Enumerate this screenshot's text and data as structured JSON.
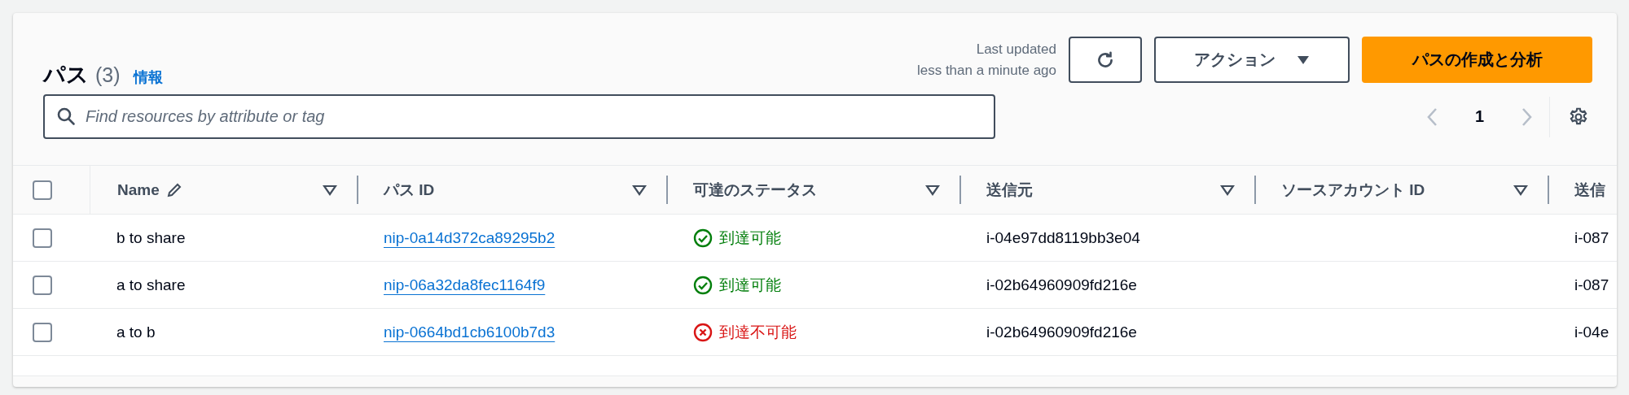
{
  "header": {
    "title": "パス",
    "count": "(3)",
    "info_link": "情報",
    "last_updated": [
      "Last updated",
      "less than a minute ago"
    ],
    "actions_button": "アクション",
    "primary_button": "パスの作成と分析"
  },
  "search": {
    "placeholder": "Find resources by attribute or tag"
  },
  "pagination": {
    "page": "1"
  },
  "table": {
    "select_all_checked": false,
    "columns": [
      {
        "label": "Name",
        "editable": true
      },
      {
        "label": "パス ID",
        "editable": false
      },
      {
        "label": "可達のステータス",
        "editable": false
      },
      {
        "label": "送信元",
        "editable": false
      },
      {
        "label": "ソースアカウント ID",
        "editable": false
      },
      {
        "label": "送信",
        "editable": false
      }
    ],
    "rows": [
      {
        "checked": false,
        "name": "b to share",
        "path_id": "nip-0a14d372ca89295b2",
        "status": {
          "kind": "reachable",
          "label": "到達可能"
        },
        "source": "i-04e97dd8119bb3e04",
        "destination": "i-087"
      },
      {
        "checked": false,
        "name": "a to share",
        "path_id": "nip-06a32da8fec1164f9",
        "status": {
          "kind": "reachable",
          "label": "到達可能"
        },
        "source": "i-02b64960909fd216e",
        "destination": "i-087"
      },
      {
        "checked": false,
        "name": "a to b",
        "path_id": "nip-0664bd1cb6100b7d3",
        "status": {
          "kind": "unreachable",
          "label": "到達不可能"
        },
        "source": "i-02b64960909fd216e",
        "destination": "i-04e"
      }
    ]
  }
}
